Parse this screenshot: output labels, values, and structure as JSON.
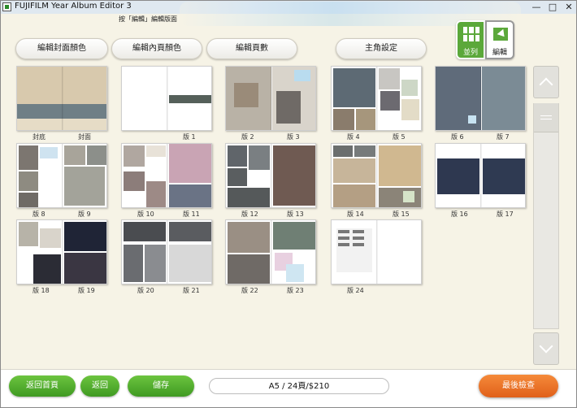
{
  "window": {
    "title": "FUJIFILM Year Album Editor 3",
    "minimize": "—",
    "maximize": "□",
    "close": "✕"
  },
  "hint": "按「編輯」編輯版面",
  "toolbar": {
    "cover_color": "編輯封面顏色",
    "inner_color": "編輯內頁顏色",
    "page_count": "編輯頁數",
    "character": "主角設定"
  },
  "view_toggle": {
    "grid_label": "並列",
    "edit_label": "編輯",
    "active": "grid"
  },
  "spreads": [
    {
      "left": "封底",
      "right": "封面"
    },
    {
      "left": "",
      "right": "版 1"
    },
    {
      "left": "版 2",
      "right": "版 3"
    },
    {
      "left": "版 4",
      "right": "版 5"
    },
    {
      "left": "版 6",
      "right": "版 7"
    },
    {
      "left": "版 8",
      "right": "版 9"
    },
    {
      "left": "版 10",
      "right": "版 11"
    },
    {
      "left": "版 12",
      "right": "版 13"
    },
    {
      "left": "版 14",
      "right": "版 15"
    },
    {
      "left": "版 16",
      "right": "版 17"
    },
    {
      "left": "版 18",
      "right": "版 19"
    },
    {
      "left": "版 20",
      "right": "版 21"
    },
    {
      "left": "版 22",
      "right": "版 23"
    },
    {
      "left": "版 24",
      "right": ""
    }
  ],
  "bottom": {
    "home": "返回首頁",
    "back": "返回",
    "save": "儲存",
    "summary": "A5 / 24頁/$210",
    "final_check": "最後檢查"
  },
  "colors": {
    "green": "#5ba83a",
    "orange": "#e8702a",
    "background": "#f6f3e6"
  },
  "icons": [
    "app-icon",
    "grid-view-icon",
    "edit-view-icon",
    "chevron-up-icon",
    "chevron-down-icon",
    "scroll-grip-icon"
  ]
}
